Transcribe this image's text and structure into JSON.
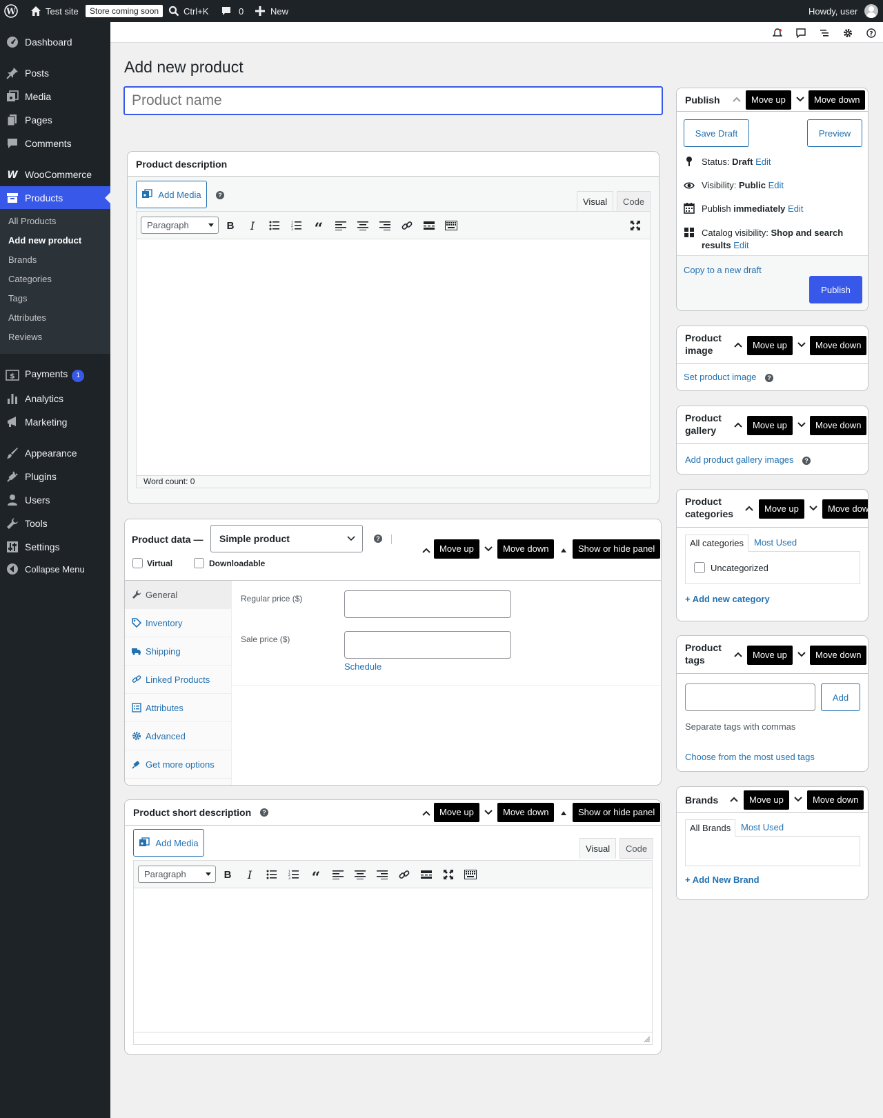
{
  "adminbar": {
    "site_name": "Test site",
    "store_badge": "Store coming soon",
    "search_shortcut": "Ctrl+K",
    "comments_count": "0",
    "new_label": "New",
    "howdy": "Howdy, user"
  },
  "sidebar": {
    "items": [
      {
        "label": "Dashboard"
      },
      {
        "label": "Posts"
      },
      {
        "label": "Media"
      },
      {
        "label": "Pages"
      },
      {
        "label": "Comments"
      },
      {
        "label": "WooCommerce"
      },
      {
        "label": "Products"
      },
      {
        "label": "Payments",
        "badge": "1"
      },
      {
        "label": "Analytics"
      },
      {
        "label": "Marketing"
      },
      {
        "label": "Appearance"
      },
      {
        "label": "Plugins"
      },
      {
        "label": "Users"
      },
      {
        "label": "Tools"
      },
      {
        "label": "Settings"
      },
      {
        "label": "Collapse Menu"
      }
    ],
    "submenu": [
      "All Products",
      "Add new product",
      "Brands",
      "Categories",
      "Tags",
      "Attributes",
      "Reviews"
    ]
  },
  "page": {
    "title": "Add new product",
    "product_name_placeholder": "Product name"
  },
  "common": {
    "move_up": "Move up",
    "move_down": "Move down",
    "move_down_cut": "Move dow",
    "show_hide": "Show or hide panel",
    "add_media": "Add Media",
    "visual": "Visual",
    "code": "Code",
    "paragraph": "Paragraph"
  },
  "description": {
    "title": "Product description",
    "word_count": "Word count: 0"
  },
  "product_data": {
    "title": "Product data —",
    "type_selected": "Simple product",
    "virtual": "Virtual",
    "downloadable": "Downloadable",
    "tabs": [
      "General",
      "Inventory",
      "Shipping",
      "Linked Products",
      "Attributes",
      "Advanced",
      "Get more options"
    ],
    "regular_price_label": "Regular price ($)",
    "sale_price_label": "Sale price ($)",
    "schedule": "Schedule"
  },
  "short_description": {
    "title": "Product short description"
  },
  "publish": {
    "title": "Publish",
    "save_draft": "Save Draft",
    "preview": "Preview",
    "status_label": "Status:",
    "status_value": "Draft",
    "visibility_label": "Visibility:",
    "visibility_value": "Public",
    "publish_label": "Publish",
    "publish_value": "immediately",
    "catalog_label": "Catalog visibility:",
    "catalog_value_1": "Shop and search",
    "catalog_value_2": "results",
    "edit": "Edit",
    "copy_draft": "Copy to a new draft",
    "publish_button": "Publish"
  },
  "product_image": {
    "title_1": "Product",
    "title_2": "image",
    "link": "Set product image"
  },
  "product_gallery": {
    "title_1": "Product",
    "title_2": "gallery",
    "link": "Add product gallery images"
  },
  "product_categories": {
    "title_1": "Product",
    "title_2": "categories",
    "tab_all": "All categories",
    "tab_most": "Most Used",
    "item": "Uncategorized",
    "add_link": "+ Add new category"
  },
  "product_tags": {
    "title_1": "Product",
    "title_2": "tags",
    "add_button": "Add",
    "hint": "Separate tags with commas",
    "choose_link": "Choose from the most used tags"
  },
  "brands": {
    "title": "Brands",
    "tab_all": "All Brands",
    "tab_most": "Most Used",
    "add_link": "+ Add New Brand"
  }
}
